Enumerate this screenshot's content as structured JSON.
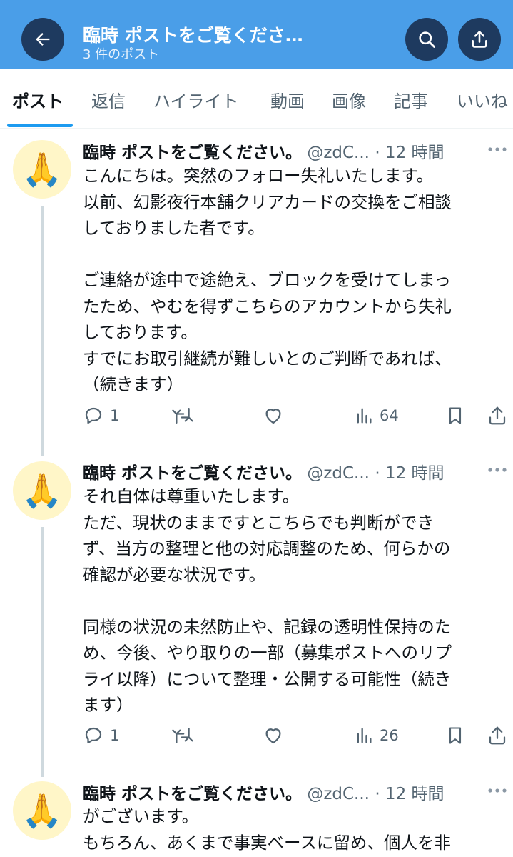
{
  "header": {
    "title": "臨時 ポストをご覧くださ…",
    "subtitle": "3 件のポスト"
  },
  "tabs": [
    {
      "label": "ポスト",
      "active": true
    },
    {
      "label": "返信"
    },
    {
      "label": "ハイライト"
    },
    {
      "label": "動画"
    },
    {
      "label": "画像"
    },
    {
      "label": "記事"
    },
    {
      "label": "いいね"
    }
  ],
  "posts": [
    {
      "name": "臨時 ポストをご覧ください。",
      "handle": "@zdC...",
      "time": "· 12 時間",
      "avatar_emoji": "🙏",
      "text": "こんにちは。突然のフォロー失礼いたします。\n以前、幻影夜行本舗クリアカードの交換をご相談\nしておりました者です。\n\nご連絡が途中で途絶え、ブロックを受けてしまっ\nたため、やむを得ずこちらのアカウントから失礼\nしております。\nすでにお取引継続が難しいとのご判断であれば、\n（続きます）",
      "replies": "1",
      "views": "64"
    },
    {
      "name": "臨時 ポストをご覧ください。",
      "handle": "@zdC...",
      "time": "· 12 時間",
      "avatar_emoji": "🙏",
      "text": "それ自体は尊重いたします。\nただ、現状のままですとこちらでも判断ができ\nず、当方の整理と他の対応調整のため、何らかの\n確認が必要な状況です。\n\n同様の状況の未然防止や、記録の透明性保持のた\nめ、今後、やり取りの一部（募集ポストへのリプ\nライ以降）について整理・公開する可能性（続き\nます）",
      "replies": "1",
      "views": "26"
    },
    {
      "name": "臨時 ポストをご覧ください。",
      "handle": "@zdC...",
      "time": "· 12 時間",
      "avatar_emoji": "🙏",
      "text": "がございます。\nもちろん、あくまで事実ベースに留め、個人を非"
    }
  ],
  "colors": {
    "header_bg": "#4a9ee8",
    "header_button": "#1e3a5f",
    "accent": "#1d9bf0",
    "muted_text": "#536471",
    "thread_line": "#cfd9de"
  }
}
